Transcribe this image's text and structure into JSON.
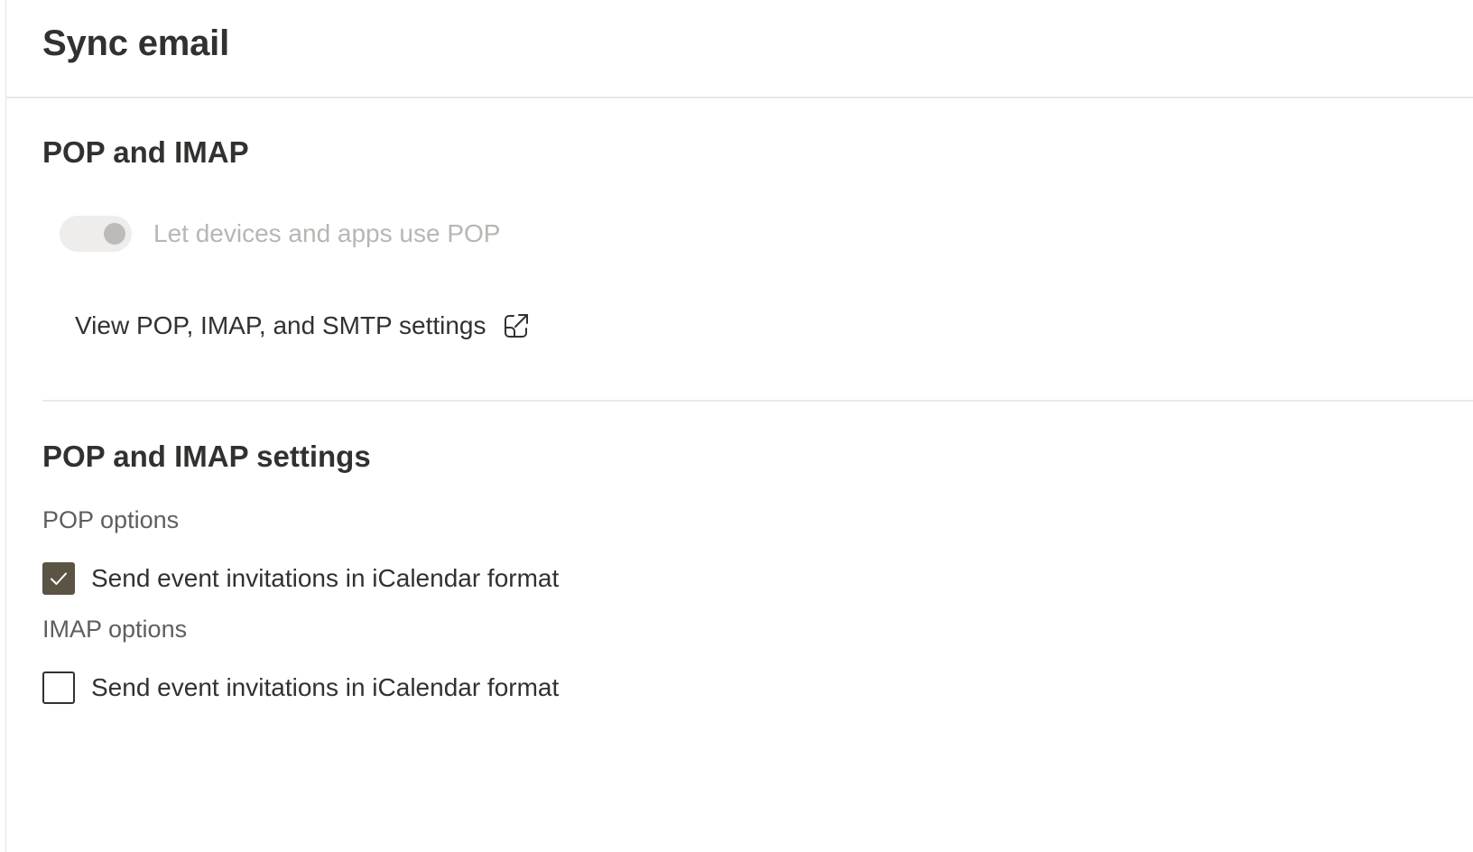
{
  "page": {
    "title": "Sync email"
  },
  "pop_imap": {
    "heading": "POP and IMAP",
    "toggle": {
      "label": "Let devices and apps use POP",
      "state": "off",
      "disabled": true
    },
    "link": {
      "label": "View POP, IMAP, and SMTP settings",
      "icon": "open-in-new-window-icon"
    }
  },
  "settings": {
    "heading": "POP and IMAP settings",
    "pop_options": {
      "label": "POP options",
      "checkbox_label": "Send event invitations in iCalendar format",
      "checked": true
    },
    "imap_options": {
      "label": "IMAP options",
      "checkbox_label": "Send event invitations in iCalendar format",
      "checked": false
    }
  },
  "colors": {
    "accent": "#5b5343",
    "text": "#323130",
    "disabled_text": "#b8b6b3",
    "divider": "#ebe9e6"
  }
}
